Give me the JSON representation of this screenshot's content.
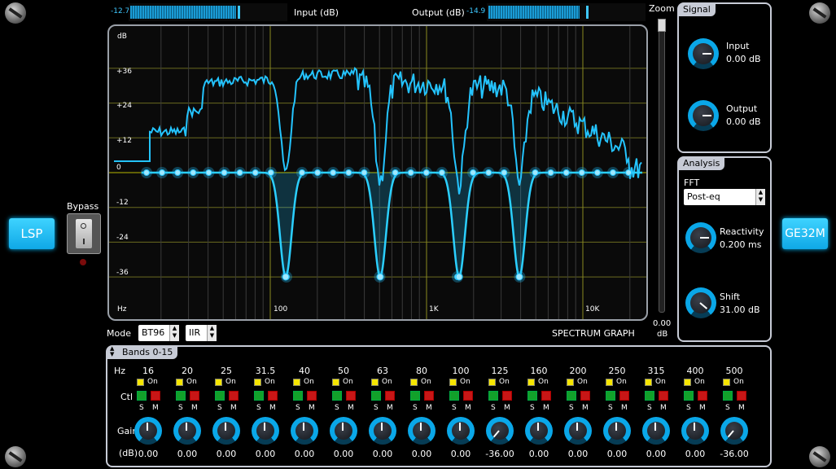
{
  "plugin": {
    "brand": "LSP",
    "model": "GE32M"
  },
  "meters": {
    "input": {
      "label": "Input (dB)",
      "value": "-12.7",
      "level": 0.62
    },
    "output": {
      "label": "Output (dB)",
      "value": "-14.9",
      "level": 0.58
    }
  },
  "graph": {
    "title": "SPECTRUM GRAPH",
    "unit_label": "dB",
    "db_ticks": [
      "+36",
      "+24",
      "+12",
      "0",
      "-12",
      "-24",
      "-36"
    ],
    "freq_unit": "Hz",
    "freq_ticks": [
      "100",
      "1K",
      "10K"
    ]
  },
  "bypass": {
    "label": "Bypass"
  },
  "mode": {
    "label": "Mode",
    "value": "BT96",
    "type_value": "IIR"
  },
  "zoom": {
    "label": "Zoom",
    "value": "0.00",
    "unit": "dB"
  },
  "signal": {
    "title": "Signal",
    "input": {
      "label": "Input",
      "value": "0.00 dB"
    },
    "output": {
      "label": "Output",
      "value": "0.00 dB"
    }
  },
  "analysis": {
    "title": "Analysis",
    "fft_label": "FFT",
    "fft_value": "Post-eq",
    "reactivity": {
      "label": "Reactivity",
      "value": "0.200 ms"
    },
    "shift": {
      "label": "Shift",
      "value": "31.00 dB"
    }
  },
  "bands": {
    "group_label": "Bands 0-15",
    "hz_label": "Hz",
    "ctl_label": "Ctl",
    "gain_label": "Gain",
    "db_label": "(dB)",
    "on_label": "On",
    "s_label": "S",
    "m_label": "M",
    "items": [
      {
        "freq": "16",
        "gain": "0.00"
      },
      {
        "freq": "20",
        "gain": "0.00"
      },
      {
        "freq": "25",
        "gain": "0.00"
      },
      {
        "freq": "31.5",
        "gain": "0.00"
      },
      {
        "freq": "40",
        "gain": "0.00"
      },
      {
        "freq": "50",
        "gain": "0.00"
      },
      {
        "freq": "63",
        "gain": "0.00"
      },
      {
        "freq": "80",
        "gain": "0.00"
      },
      {
        "freq": "100",
        "gain": "0.00"
      },
      {
        "freq": "125",
        "gain": "-36.00"
      },
      {
        "freq": "160",
        "gain": "0.00"
      },
      {
        "freq": "200",
        "gain": "0.00"
      },
      {
        "freq": "250",
        "gain": "0.00"
      },
      {
        "freq": "315",
        "gain": "0.00"
      },
      {
        "freq": "400",
        "gain": "0.00"
      },
      {
        "freq": "500",
        "gain": "-36.00"
      }
    ]
  },
  "colors": {
    "accent": "#0aa7e8",
    "curve": "#24c4ff",
    "panel_border": "#c7cbd6"
  }
}
